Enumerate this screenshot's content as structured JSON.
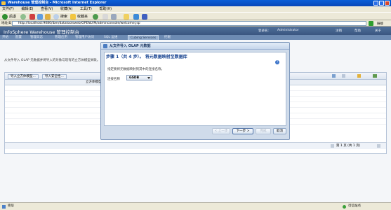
{
  "window": {
    "title": "Warehouse 管理控制台 - Microsoft Internet Explorer"
  },
  "menu": [
    "文件(F)",
    "编辑(E)",
    "查看(V)",
    "收藏(A)",
    "工具(T)",
    "帮助(H)"
  ],
  "toolbar": {
    "back": "后退",
    "search": "搜索",
    "favorites": "收藏夹"
  },
  "address": {
    "label": "地址(D)",
    "url": "http://localhost:9080/ibm/datatoolsweb/OPENLYM/adminconsole/welcome.jsp",
    "go": "转到",
    "links": "链接"
  },
  "app": {
    "title": "InfoSphere Warehouse 管理控制台",
    "user_label": "登录名:",
    "user": "Administrator",
    "header_links": [
      "注销",
      "帮助",
      "关于"
    ]
  },
  "nav": {
    "tabs": [
      "开始",
      "配置",
      "管理日志",
      "管理应用",
      "管理用户访问",
      "SQL 运维",
      "Cubing Services",
      "挖掘"
    ],
    "active": "Cubing Services"
  },
  "page": {
    "description": "从文件导入 OLAP 元数据并将导入的对象与现有的立方体模型关联。"
  },
  "grid": {
    "buttons": [
      "导入立方体模型...",
      "导入安全性..."
    ],
    "column": "立方体模型",
    "footer": "第 1 页 (共 1 页)"
  },
  "dialog": {
    "title": "从文件导入 OLAP 元数据",
    "step": "步骤 1（共 4 步）。  将元数据映射至数据库",
    "hint": "指定要将元数据映射到其中的连接名称。",
    "connection_label": "连接名称",
    "connection_value": "GSDB",
    "buttons": {
      "back": "< 上一步",
      "next": "下一步 >",
      "finish": "完成",
      "cancel": "取消"
    }
  },
  "status": {
    "left": "完毕",
    "zone": "可信站点"
  }
}
